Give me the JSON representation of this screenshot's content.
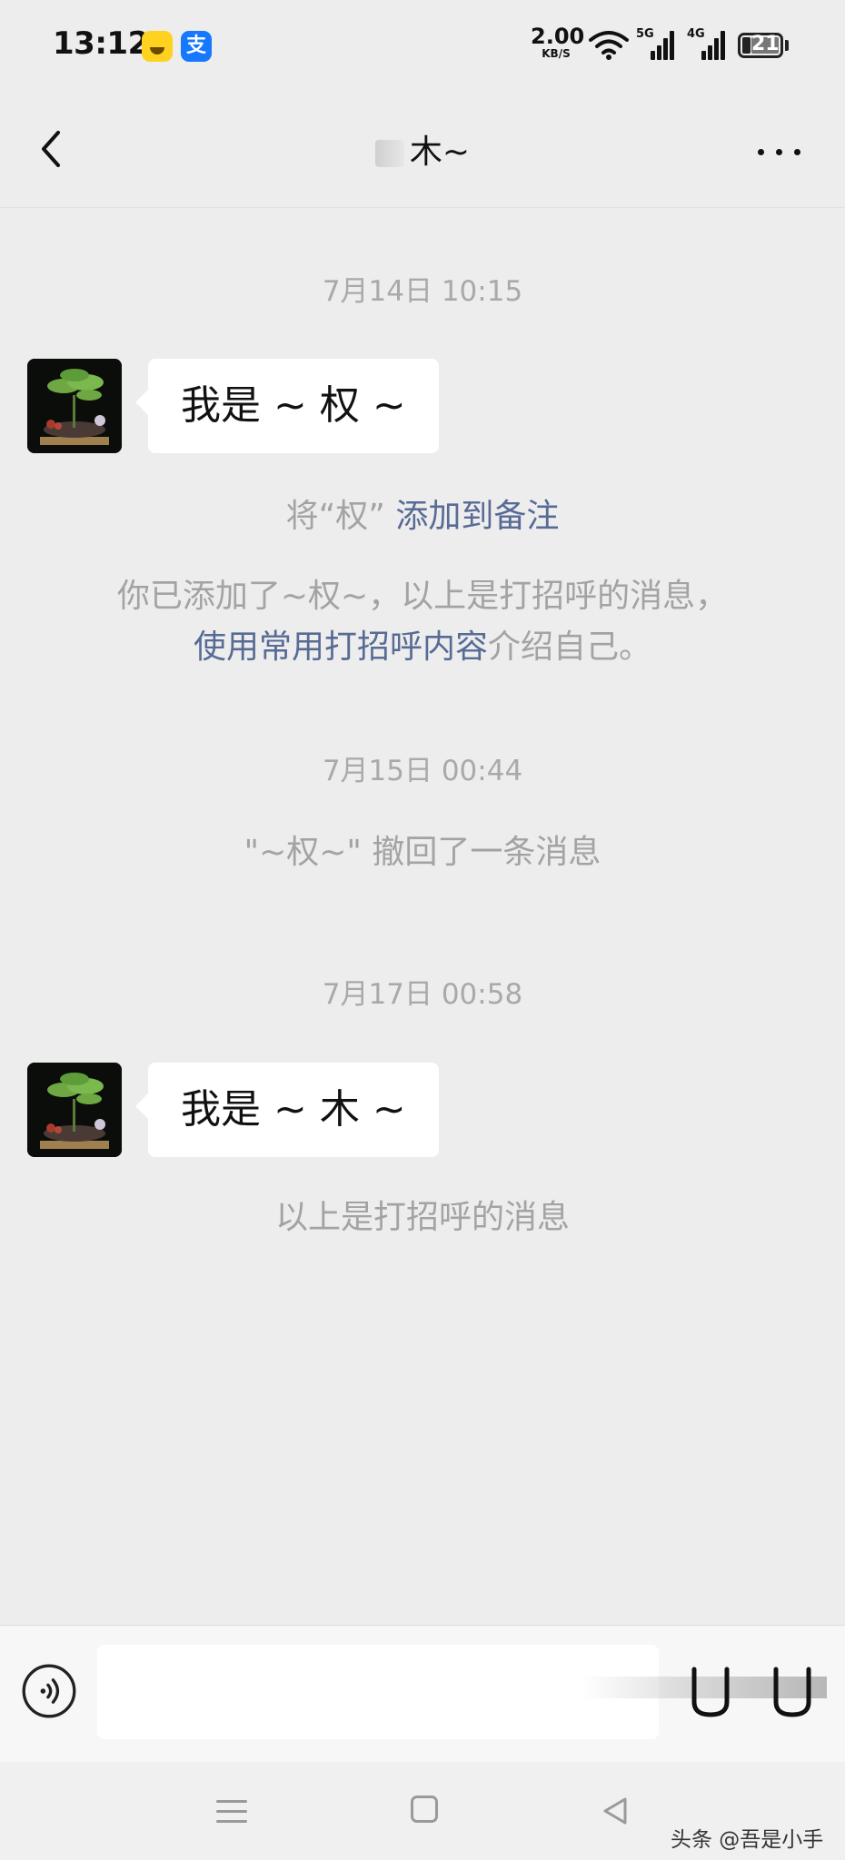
{
  "status_bar": {
    "time": "13:12",
    "net_speed_value": "2.00",
    "net_speed_unit": "KB/S",
    "signal_1_label": "5G",
    "signal_2_label": "4G",
    "battery_level": "21",
    "app_icon_2_glyph": "支"
  },
  "header": {
    "title": "木~"
  },
  "chat": {
    "timestamp_1": "7月14日 10:15",
    "message_1": "我是 ~ 权 ~",
    "notice_remark_prefix": "将“权”",
    "notice_remark_link": "添加到备注",
    "notice_added_line1": "你已添加了~权~，以上是打招呼的消息，",
    "notice_added_link": "使用常用打招呼内容",
    "notice_added_suffix": "介绍自己。",
    "timestamp_2": "7月15日 00:44",
    "notice_recalled": "\"~权~\" 撤回了一条消息",
    "timestamp_3": "7月17日 00:58",
    "message_2": "我是 ~ 木 ~",
    "notice_greeting": "以上是打招呼的消息"
  },
  "input_bar": {
    "value": "",
    "placeholder": ""
  },
  "watermark": "头条 @吾是小手",
  "icons": {
    "back": "chevron-left-icon",
    "more": "more-dots-icon",
    "voice": "voice-icon",
    "emoji": "emoji-icon",
    "plus": "plus-icon"
  },
  "colors": {
    "background": "#ededed",
    "bubble": "#ffffff",
    "link": "#576b95",
    "system_text": "#a3a3a3"
  }
}
